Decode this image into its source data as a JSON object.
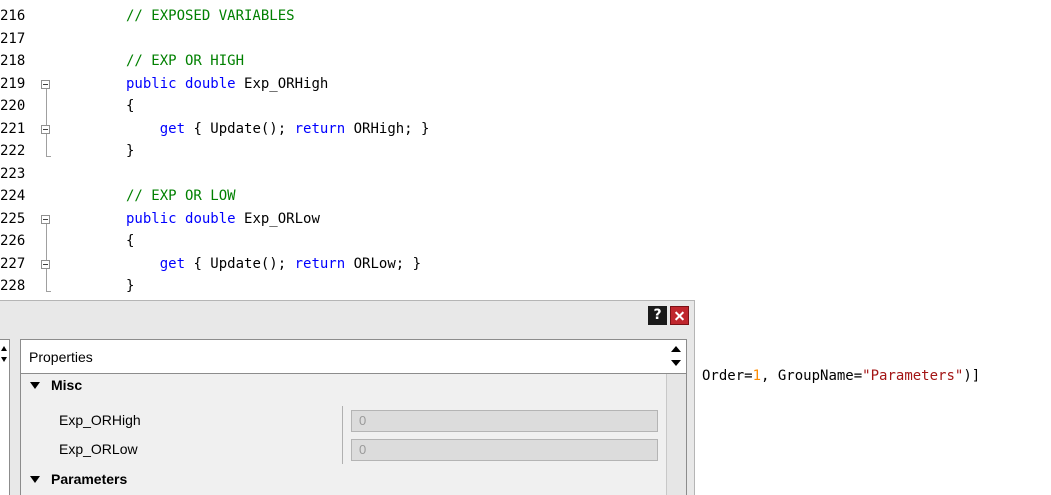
{
  "editor": {
    "lines": [
      {
        "num": "216",
        "indent": "",
        "tokens": [
          {
            "t": "cm",
            "v": "// EXPOSED VARIABLES"
          }
        ]
      },
      {
        "num": "217",
        "indent": "",
        "tokens": []
      },
      {
        "num": "218",
        "indent": "",
        "tokens": [
          {
            "t": "cm",
            "v": "// EXP OR HIGH"
          }
        ]
      },
      {
        "num": "219",
        "indent": "",
        "tokens": [
          {
            "t": "kw",
            "v": "public"
          },
          {
            "t": "tx",
            "v": " "
          },
          {
            "t": "kw",
            "v": "double"
          },
          {
            "t": "tx",
            "v": " Exp_ORHigh"
          }
        ]
      },
      {
        "num": "220",
        "indent": "",
        "tokens": [
          {
            "t": "tx",
            "v": "{"
          }
        ]
      },
      {
        "num": "221",
        "indent": "    ",
        "tokens": [
          {
            "t": "kw",
            "v": "get"
          },
          {
            "t": "tx",
            "v": " { Update(); "
          },
          {
            "t": "kw",
            "v": "return"
          },
          {
            "t": "tx",
            "v": " ORHigh; }"
          }
        ]
      },
      {
        "num": "222",
        "indent": "",
        "tokens": [
          {
            "t": "tx",
            "v": "}"
          }
        ]
      },
      {
        "num": "223",
        "indent": "",
        "tokens": []
      },
      {
        "num": "224",
        "indent": "",
        "tokens": [
          {
            "t": "cm",
            "v": "// EXP OR LOW"
          }
        ]
      },
      {
        "num": "225",
        "indent": "",
        "tokens": [
          {
            "t": "kw",
            "v": "public"
          },
          {
            "t": "tx",
            "v": " "
          },
          {
            "t": "kw",
            "v": "double"
          },
          {
            "t": "tx",
            "v": " Exp_ORLow"
          }
        ]
      },
      {
        "num": "226",
        "indent": "",
        "tokens": [
          {
            "t": "tx",
            "v": "{"
          }
        ]
      },
      {
        "num": "227",
        "indent": "    ",
        "tokens": [
          {
            "t": "kw",
            "v": "get"
          },
          {
            "t": "tx",
            "v": " { Update(); "
          },
          {
            "t": "kw",
            "v": "return"
          },
          {
            "t": "tx",
            "v": " ORLow; }"
          }
        ]
      },
      {
        "num": "228",
        "indent": "",
        "tokens": [
          {
            "t": "tx",
            "v": "}"
          }
        ]
      }
    ],
    "partial_line": {
      "tokens": [
        {
          "t": "tx",
          "v": "Order="
        },
        {
          "t": "num",
          "v": "1"
        },
        {
          "t": "tx",
          "v": ", GroupName="
        },
        {
          "t": "str",
          "v": "\"Parameters\""
        },
        {
          "t": "tx",
          "v": ")]"
        }
      ]
    }
  },
  "dialog": {
    "help_label": "?",
    "close_icon": "close-icon",
    "properties_title": "Properties",
    "categories": [
      {
        "label": "Misc",
        "expanded": true
      },
      {
        "label": "Parameters",
        "expanded": true
      }
    ],
    "properties": [
      {
        "name": "Exp_ORHigh",
        "value": "0"
      },
      {
        "name": "Exp_ORLow",
        "value": "0"
      }
    ]
  },
  "colors": {
    "keyword": "#0000ff",
    "comment": "#008000",
    "number": "#ff8c00",
    "string": "#a31515",
    "close_button": "#c0262d"
  }
}
